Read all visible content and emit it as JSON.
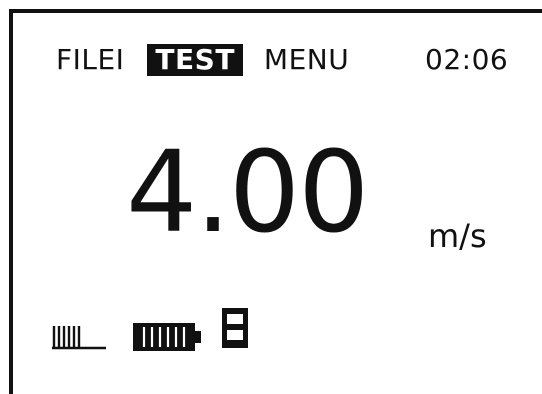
{
  "menu": {
    "items": [
      {
        "label": "FILEI"
      },
      {
        "label": "TEST",
        "selected": true
      },
      {
        "label": "MENU"
      }
    ]
  },
  "clock": "02:06",
  "measurement": {
    "value": "4.00",
    "unit": "m/s"
  },
  "status": {
    "icons": [
      "signal-strength-icon",
      "battery-full-icon",
      "storage-card-icon"
    ],
    "battery_level": 1.0
  }
}
